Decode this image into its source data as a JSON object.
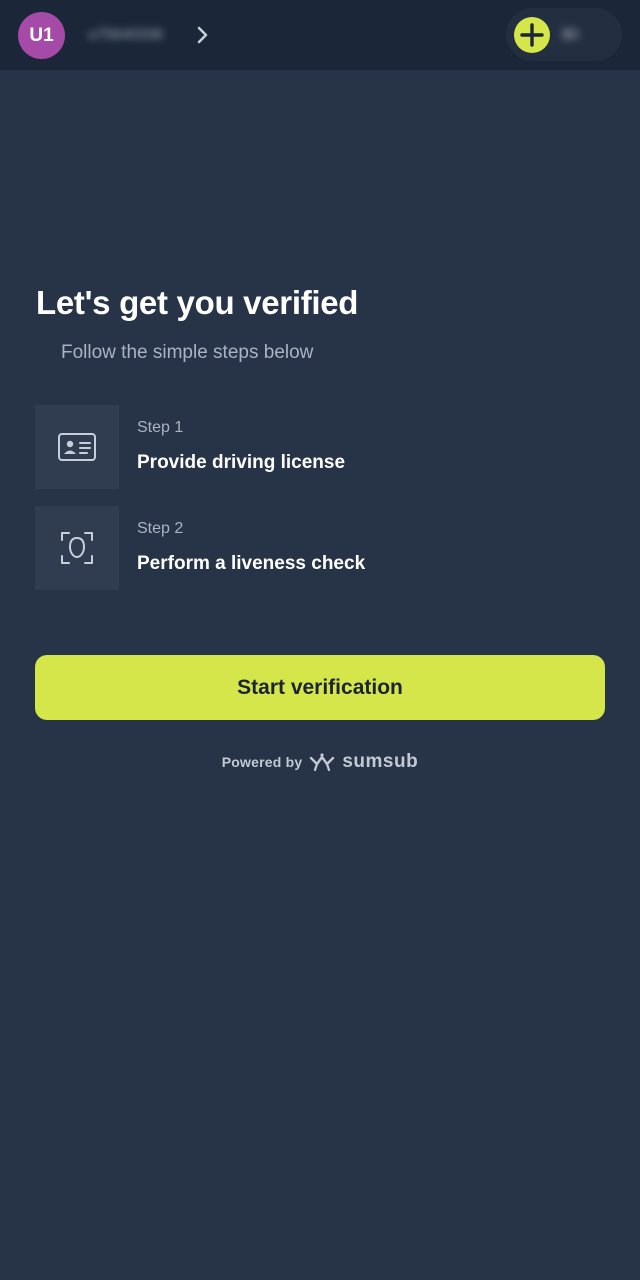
{
  "header": {
    "avatar_initials": "U1",
    "username": "u75640336",
    "balance": "$0"
  },
  "main": {
    "title": "Let's get you verified",
    "subtitle": "Follow the simple steps below",
    "steps": [
      {
        "label": "Step 1",
        "text": "Provide driving license",
        "icon": "id-card-icon"
      },
      {
        "label": "Step 2",
        "text": "Perform a liveness check",
        "icon": "face-scan-icon"
      }
    ],
    "start_button": "Start verification"
  },
  "footer": {
    "powered_by": "Powered by",
    "brand": "sumsub"
  },
  "colors": {
    "background": "#273347",
    "header_background": "#1b2639",
    "accent": "#d4e64a",
    "avatar": "#a54aa6"
  }
}
